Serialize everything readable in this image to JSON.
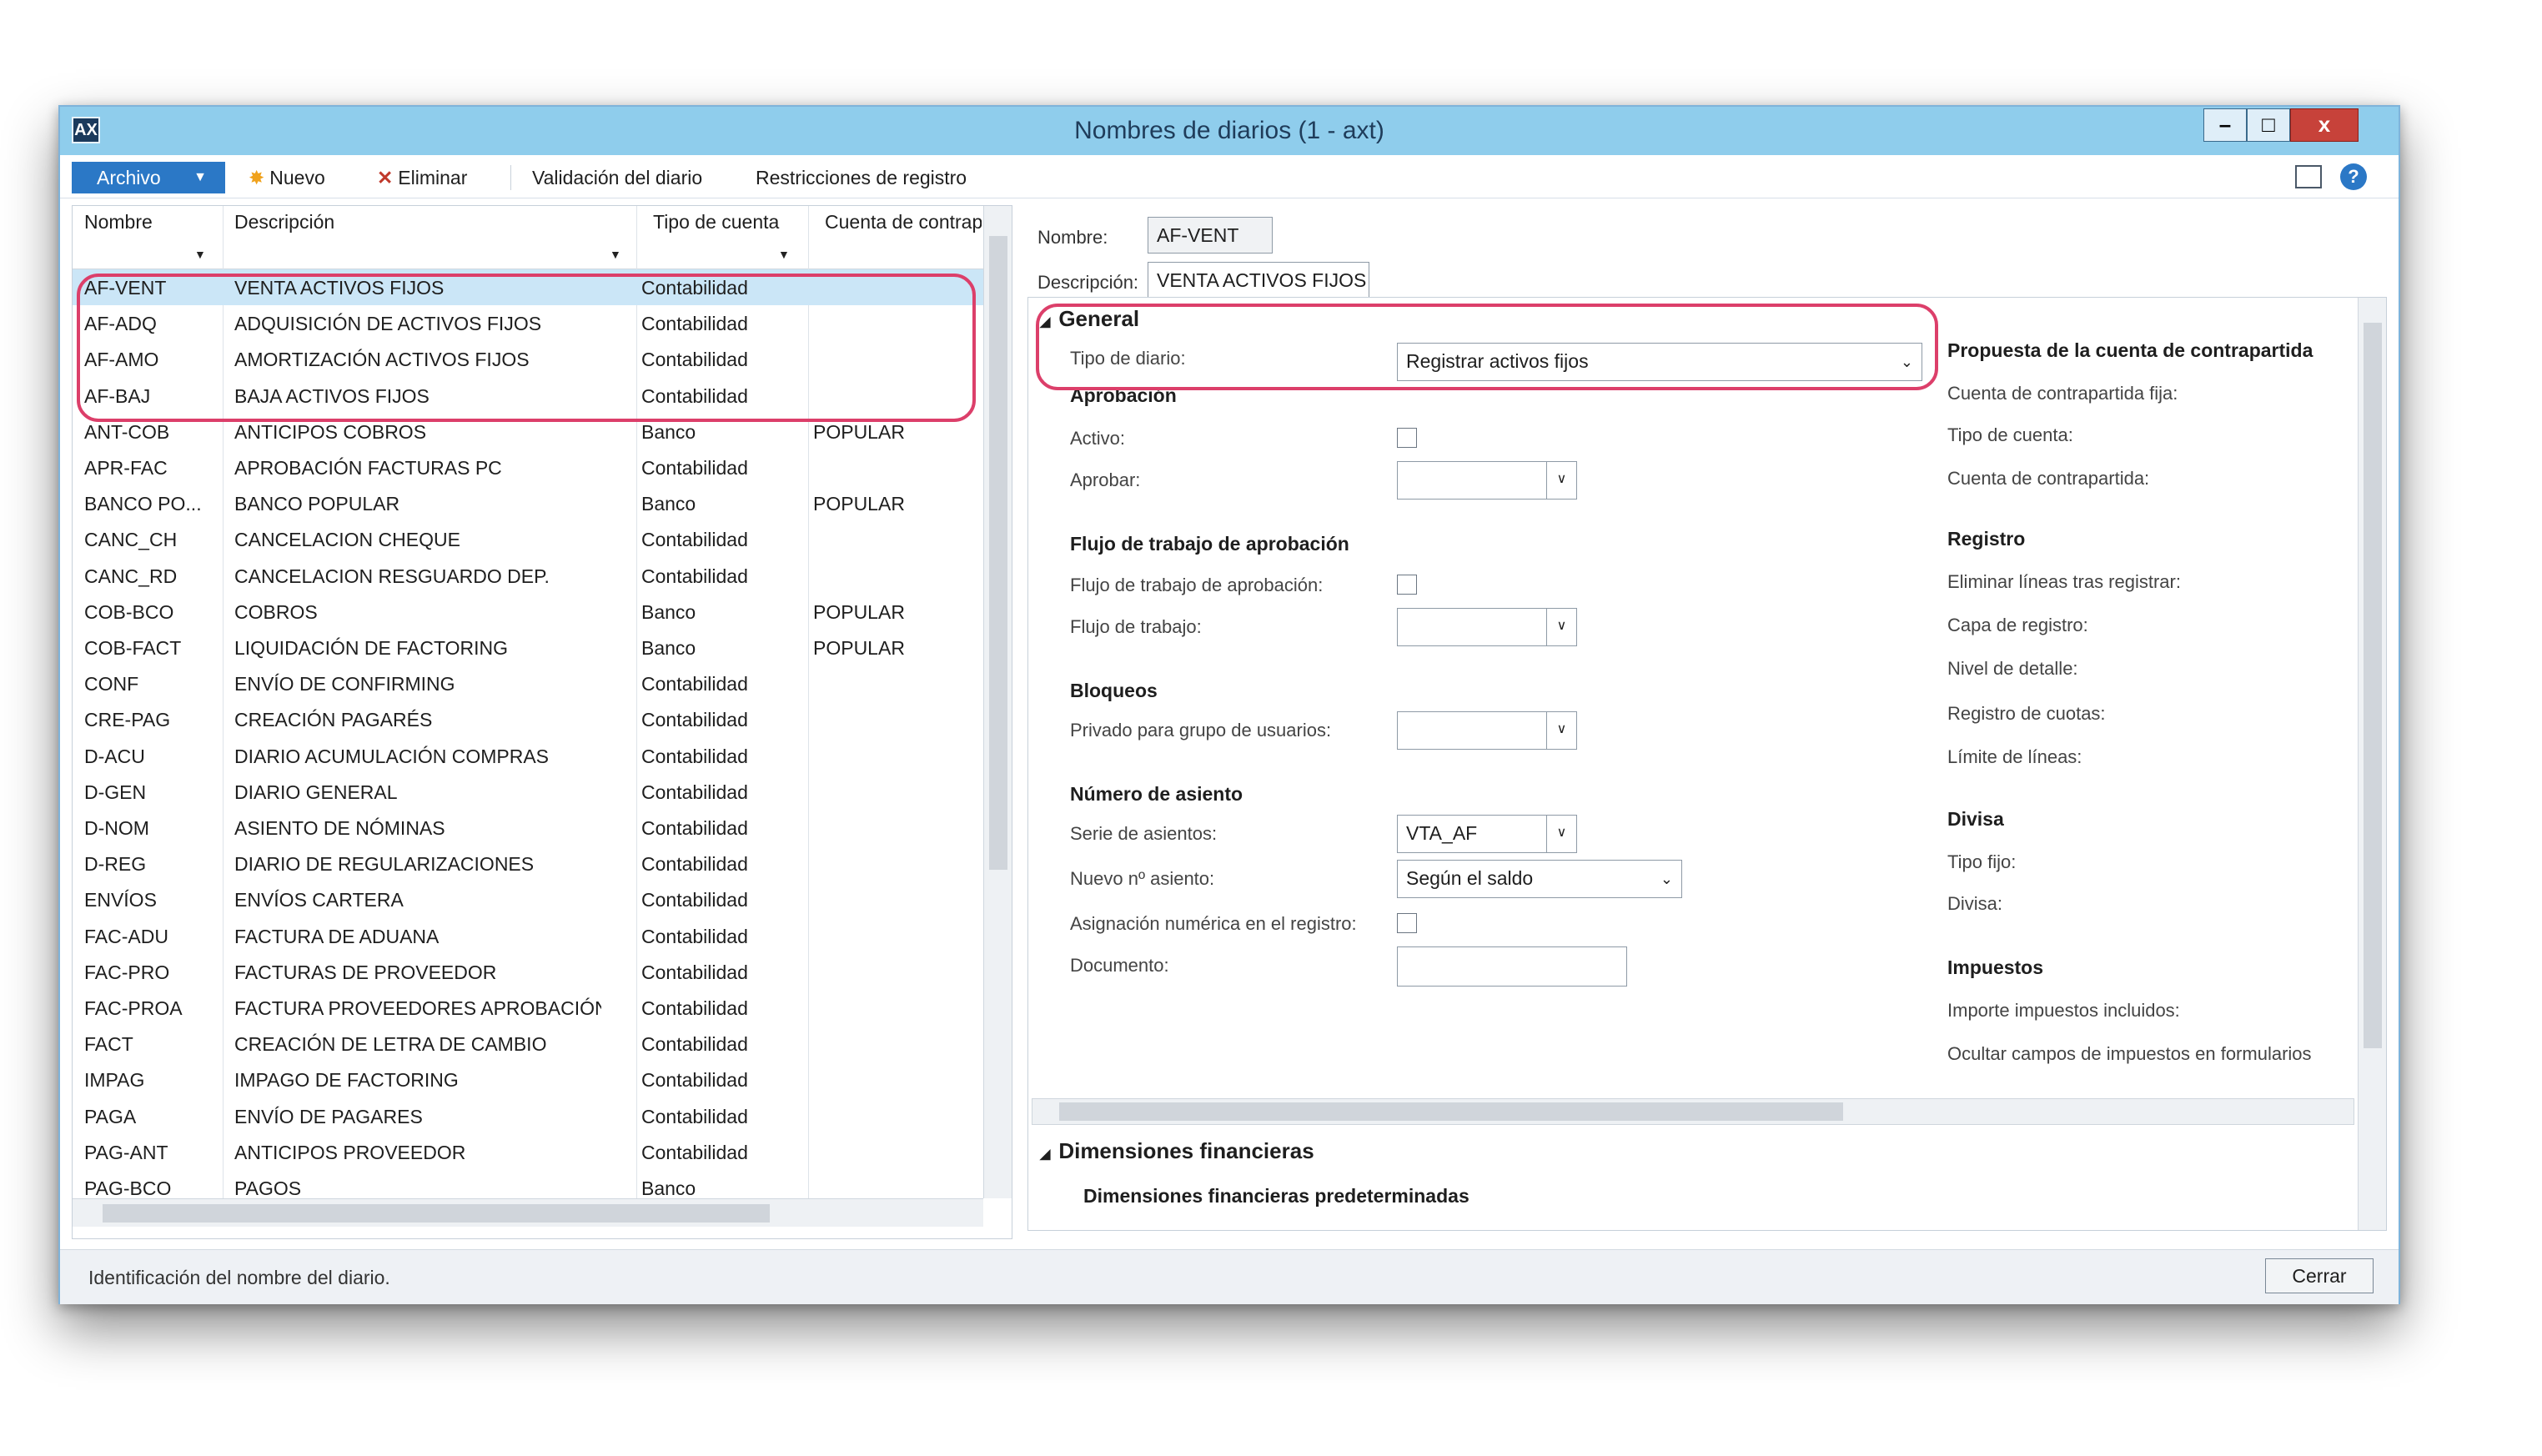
{
  "window": {
    "title": "Nombres de diarios (1 - axt)",
    "icon_label": "AX"
  },
  "window_controls": {
    "min": "–",
    "max": "□",
    "close": "x"
  },
  "toolbar": {
    "archivo": "Archivo",
    "nuevo": "Nuevo",
    "eliminar": "Eliminar",
    "validacion": "Validación del diario",
    "restricciones": "Restricciones de registro",
    "help": "?"
  },
  "grid": {
    "columns": [
      "Nombre",
      "Descripción",
      "Tipo de cuenta",
      "Cuenta de contrapa"
    ],
    "rows": [
      {
        "nombre": "AF-VENT",
        "descripcion": "VENTA ACTIVOS FIJOS",
        "tipo": "Contabilidad",
        "cuenta": ""
      },
      {
        "nombre": "AF-ADQ",
        "descripcion": "ADQUISICIÓN DE ACTIVOS FIJOS",
        "tipo": "Contabilidad",
        "cuenta": ""
      },
      {
        "nombre": "AF-AMO",
        "descripcion": "AMORTIZACIÓN ACTIVOS FIJOS",
        "tipo": "Contabilidad",
        "cuenta": ""
      },
      {
        "nombre": "AF-BAJ",
        "descripcion": "BAJA ACTIVOS FIJOS",
        "tipo": "Contabilidad",
        "cuenta": ""
      },
      {
        "nombre": "ANT-COB",
        "descripcion": "ANTICIPOS COBROS",
        "tipo": "Banco",
        "cuenta": "POPULAR"
      },
      {
        "nombre": "APR-FAC",
        "descripcion": "APROBACIÓN FACTURAS PC",
        "tipo": "Contabilidad",
        "cuenta": ""
      },
      {
        "nombre": "BANCO PO...",
        "descripcion": "BANCO POPULAR",
        "tipo": "Banco",
        "cuenta": "POPULAR"
      },
      {
        "nombre": "CANC_CH",
        "descripcion": "CANCELACION CHEQUE",
        "tipo": "Contabilidad",
        "cuenta": ""
      },
      {
        "nombre": "CANC_RD",
        "descripcion": "CANCELACION RESGUARDO DEP.",
        "tipo": "Contabilidad",
        "cuenta": ""
      },
      {
        "nombre": "COB-BCO",
        "descripcion": "COBROS",
        "tipo": "Banco",
        "cuenta": "POPULAR"
      },
      {
        "nombre": "COB-FACT",
        "descripcion": "LIQUIDACIÓN DE FACTORING",
        "tipo": "Banco",
        "cuenta": "POPULAR"
      },
      {
        "nombre": "CONF",
        "descripcion": "ENVÍO DE CONFIRMING",
        "tipo": "Contabilidad",
        "cuenta": ""
      },
      {
        "nombre": "CRE-PAG",
        "descripcion": "CREACIÓN PAGARÉS",
        "tipo": "Contabilidad",
        "cuenta": ""
      },
      {
        "nombre": "D-ACU",
        "descripcion": "DIARIO ACUMULACIÓN COMPRAS",
        "tipo": "Contabilidad",
        "cuenta": ""
      },
      {
        "nombre": "D-GEN",
        "descripcion": "DIARIO GENERAL",
        "tipo": "Contabilidad",
        "cuenta": ""
      },
      {
        "nombre": "D-NOM",
        "descripcion": "ASIENTO DE NÓMINAS",
        "tipo": "Contabilidad",
        "cuenta": ""
      },
      {
        "nombre": "D-REG",
        "descripcion": "DIARIO DE REGULARIZACIONES",
        "tipo": "Contabilidad",
        "cuenta": ""
      },
      {
        "nombre": "ENVÍOS",
        "descripcion": "ENVÍOS CARTERA",
        "tipo": "Contabilidad",
        "cuenta": ""
      },
      {
        "nombre": "FAC-ADU",
        "descripcion": "FACTURA DE ADUANA",
        "tipo": "Contabilidad",
        "cuenta": ""
      },
      {
        "nombre": "FAC-PRO",
        "descripcion": "FACTURAS DE PROVEEDOR",
        "tipo": "Contabilidad",
        "cuenta": ""
      },
      {
        "nombre": "FAC-PROA",
        "descripcion": "FACTURA PROVEEDORES APROBACIÓN",
        "tipo": "Contabilidad",
        "cuenta": ""
      },
      {
        "nombre": "FACT",
        "descripcion": "CREACIÓN DE LETRA DE CAMBIO",
        "tipo": "Contabilidad",
        "cuenta": ""
      },
      {
        "nombre": "IMPAG",
        "descripcion": "IMPAGO DE FACTORING",
        "tipo": "Contabilidad",
        "cuenta": ""
      },
      {
        "nombre": "PAGA",
        "descripcion": "ENVÍO DE PAGARES",
        "tipo": "Contabilidad",
        "cuenta": ""
      },
      {
        "nombre": "PAG-ANT",
        "descripcion": "ANTICIPOS PROVEEDOR",
        "tipo": "Contabilidad",
        "cuenta": ""
      },
      {
        "nombre": "PAG-BCO",
        "descripcion": "PAGOS",
        "tipo": "Banco",
        "cuenta": ""
      }
    ]
  },
  "header_fields": {
    "nombre_label": "Nombre:",
    "nombre_value": "AF-VENT",
    "descripcion_label": "Descripción:",
    "descripcion_value": "VENTA ACTIVOS FIJOS"
  },
  "general": {
    "section": "General",
    "tipo_diario_label": "Tipo de diario:",
    "tipo_diario_value": "Registrar activos fijos",
    "aprobacion": "Aprobación",
    "activo_label": "Activo:",
    "aprobar_label": "Aprobar:",
    "flujo_group": "Flujo de trabajo de aprobación",
    "flujo_label": "Flujo de trabajo de aprobación:",
    "flujo_trabajo_label": "Flujo de trabajo:",
    "bloqueos": "Bloqueos",
    "privado_label": "Privado para grupo de usuarios:",
    "numero_asiento": "Número de asiento",
    "serie_label": "Serie de asientos:",
    "serie_value": "VTA_AF",
    "nuevo_label": "Nuevo nº asiento:",
    "nuevo_value": "Según el saldo",
    "asignacion_label": "Asignación numérica en el registro:",
    "documento_label": "Documento:"
  },
  "right_column": {
    "propuesta": "Propuesta de la cuenta de contrapartida",
    "fija": "Cuenta de contrapartida fija:",
    "tipo_cuenta": "Tipo de cuenta:",
    "cuenta_contra": "Cuenta de contrapartida:",
    "registro": "Registro",
    "eliminar_lineas": "Eliminar líneas tras registrar:",
    "capa": "Capa de registro:",
    "nivel": "Nivel de detalle:",
    "registro_cuotas": "Registro de cuotas:",
    "limite": "Límite de líneas:",
    "divisa": "Divisa",
    "tipo_fijo": "Tipo fijo:",
    "divisa_label": "Divisa:",
    "impuestos": "Impuestos",
    "importe_impuestos": "Importe impuestos incluidos:",
    "ocultar": "Ocultar campos de impuestos en formularios"
  },
  "dimensiones": {
    "section": "Dimensiones financieras",
    "sub": "Dimensiones financieras predeterminadas"
  },
  "status": {
    "text": "Identificación del nombre del diario.",
    "cerrar": "Cerrar"
  },
  "colors": {
    "accent": "#2b78c6",
    "titlebar": "#8fcdec",
    "highlight": "#dc3f6a",
    "selected_row": "#cbe6f7"
  }
}
